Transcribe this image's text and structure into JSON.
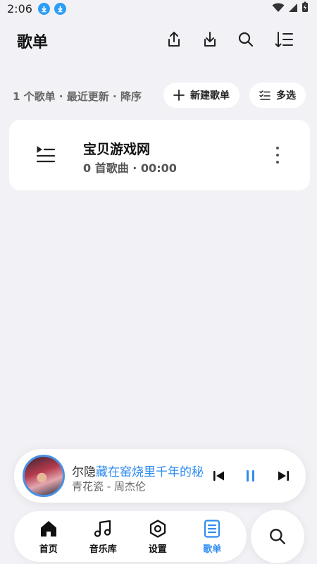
{
  "status": {
    "time": "2:06"
  },
  "header": {
    "title": "歌单"
  },
  "toolbar": {
    "summary": "1 个歌单 · 最近更新 · 降序",
    "new_playlist": "新建歌单",
    "multi_select": "多选"
  },
  "playlists": [
    {
      "name": "宝贝游戏网",
      "meta": "0 首歌曲 · 00:00"
    }
  ],
  "player": {
    "lyric_played": "尔隐",
    "lyric_rest": "藏在窑烧里千年的秘",
    "song": "青花瓷 - 周杰伦"
  },
  "nav": {
    "items": [
      {
        "label": "首页",
        "icon": "home-icon"
      },
      {
        "label": "音乐库",
        "icon": "music-note-icon"
      },
      {
        "label": "设置",
        "icon": "settings-icon"
      },
      {
        "label": "歌单",
        "icon": "playlist-icon"
      }
    ],
    "active_index": 3
  },
  "colors": {
    "accent": "#2f8cf0",
    "background": "#f2f2f6",
    "download_badge": "#2b9df4"
  }
}
